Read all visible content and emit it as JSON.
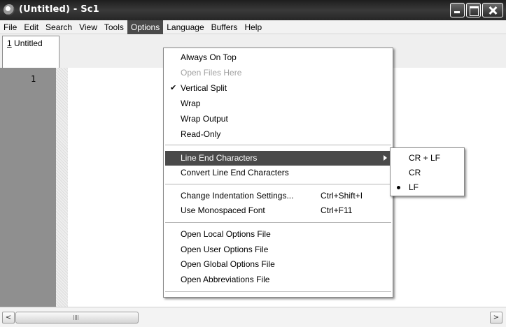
{
  "window": {
    "title": "(Untitled) - Sc1"
  },
  "menubar": {
    "items": [
      "File",
      "Edit",
      "Search",
      "View",
      "Tools",
      "Options",
      "Language",
      "Buffers",
      "Help"
    ],
    "open_item": "Options"
  },
  "tabs": [
    {
      "number": "1",
      "label": " Untitled",
      "active": true
    }
  ],
  "editor": {
    "line_numbers": [
      "1"
    ]
  },
  "options_menu": {
    "items": [
      {
        "label": "Always On Top",
        "enabled": true,
        "checked": false
      },
      {
        "label": "Open Files Here",
        "enabled": false,
        "checked": false
      },
      {
        "label": "Vertical Split",
        "enabled": true,
        "checked": true
      },
      {
        "label": "Wrap",
        "enabled": true,
        "checked": false
      },
      {
        "label": "Wrap Output",
        "enabled": true,
        "checked": false
      },
      {
        "label": "Read-Only",
        "enabled": true,
        "checked": false
      },
      {
        "label": "Line End Characters",
        "enabled": true,
        "highlighted": true,
        "submenu": true
      },
      {
        "label": "Convert Line End Characters",
        "enabled": true
      },
      {
        "label": "Change Indentation Settings...",
        "shortcut": "Ctrl+Shift+I",
        "enabled": true
      },
      {
        "label": "Use Monospaced Font",
        "shortcut": "Ctrl+F11",
        "enabled": true
      },
      {
        "label": "Open Local Options File",
        "enabled": true
      },
      {
        "label": "Open User Options File",
        "enabled": true
      },
      {
        "label": "Open Global Options File",
        "enabled": true
      },
      {
        "label": "Open Abbreviations File",
        "enabled": true
      }
    ]
  },
  "line_end_submenu": {
    "items": [
      {
        "label": "CR + LF",
        "selected": false
      },
      {
        "label": "CR",
        "selected": false
      },
      {
        "label": "LF",
        "selected": true
      }
    ]
  },
  "icons": {
    "check": "✔",
    "scroll_left": "<",
    "scroll_right": ">"
  }
}
